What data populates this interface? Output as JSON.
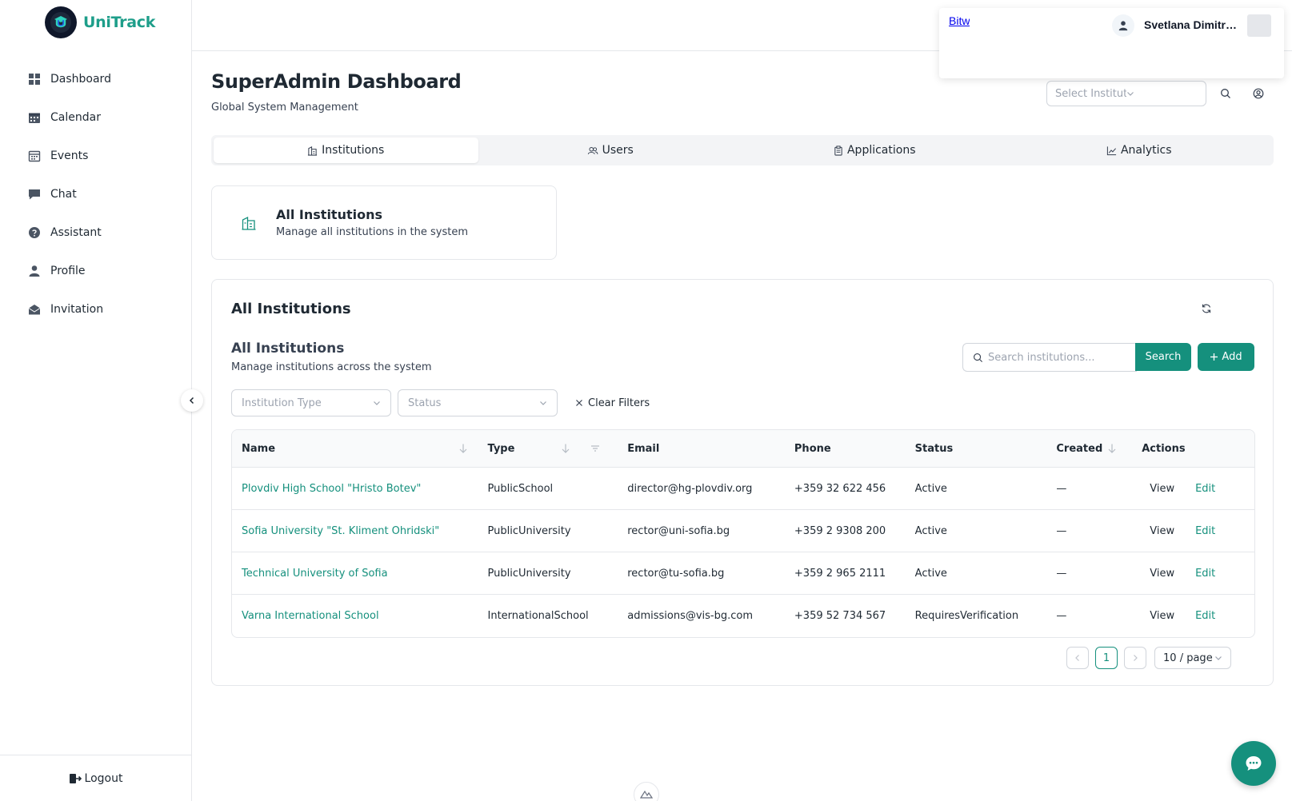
{
  "app": {
    "name": "UniTrack"
  },
  "sidebar": {
    "items": [
      {
        "label": "Dashboard",
        "icon": "dashboard-icon"
      },
      {
        "label": "Calendar",
        "icon": "calendar-icon"
      },
      {
        "label": "Events",
        "icon": "events-icon"
      },
      {
        "label": "Chat",
        "icon": "chat-icon"
      },
      {
        "label": "Assistant",
        "icon": "help-icon"
      },
      {
        "label": "Profile",
        "icon": "user-icon"
      },
      {
        "label": "Invitation",
        "icon": "mail-open-icon"
      }
    ],
    "logout_label": "Logout"
  },
  "user": {
    "link_text": "Bitwarden",
    "name": "Svetlana Dimitrova"
  },
  "header": {
    "title": "SuperAdmin Dashboard",
    "subtitle": "Global System Management",
    "institution_select_placeholder": "Select Institution to Manage"
  },
  "tabs": [
    {
      "label": "Institutions",
      "icon": "building-icon",
      "active": true
    },
    {
      "label": "Users",
      "icon": "users-icon",
      "active": false
    },
    {
      "label": "Applications",
      "icon": "clipboard-icon",
      "active": false
    },
    {
      "label": "Analytics",
      "icon": "line-chart-icon",
      "active": false
    }
  ],
  "summary_card": {
    "title": "All Institutions",
    "description": "Manage all institutions in the system"
  },
  "panel": {
    "title": "All Institutions",
    "section_title": "All Institutions",
    "section_description": "Manage institutions across the system",
    "search_placeholder": "Search institutions...",
    "search_button": "Search",
    "add_button": "Add",
    "filter_type_placeholder": "Institution Type",
    "filter_status_placeholder": "Status",
    "clear_filters": "Clear Filters"
  },
  "table": {
    "columns": [
      "Name",
      "Type",
      "Email",
      "Phone",
      "Status",
      "Created",
      "Actions"
    ],
    "rows": [
      {
        "name": "Plovdiv High School \"Hristo Botev\"",
        "type": "PublicSchool",
        "email": "director@hg-plovdiv.org",
        "phone": "+359 32 622 456",
        "status": "Active",
        "created": "—"
      },
      {
        "name": "Sofia University \"St. Kliment Ohridski\"",
        "type": "PublicUniversity",
        "email": "rector@uni-sofia.bg",
        "phone": "+359 2 9308 200",
        "status": "Active",
        "created": "—"
      },
      {
        "name": "Technical University of Sofia",
        "type": "PublicUniversity",
        "email": "rector@tu-sofia.bg",
        "phone": "+359 2 965 2111",
        "status": "Active",
        "created": "—"
      },
      {
        "name": "Varna International School",
        "type": "InternationalSchool",
        "email": "admissions@vis-bg.com",
        "phone": "+359 52 734 567",
        "status": "RequiresVerification",
        "created": "—"
      }
    ],
    "action_view": "View",
    "action_edit": "Edit"
  },
  "pagination": {
    "current_page": "1",
    "page_size_value": "10",
    "page_size_separator": "/",
    "page_size_unit": "page"
  },
  "colors": {
    "accent": "#15907d",
    "logo_text": "#1e9e8a",
    "border": "#e5e7eb"
  }
}
